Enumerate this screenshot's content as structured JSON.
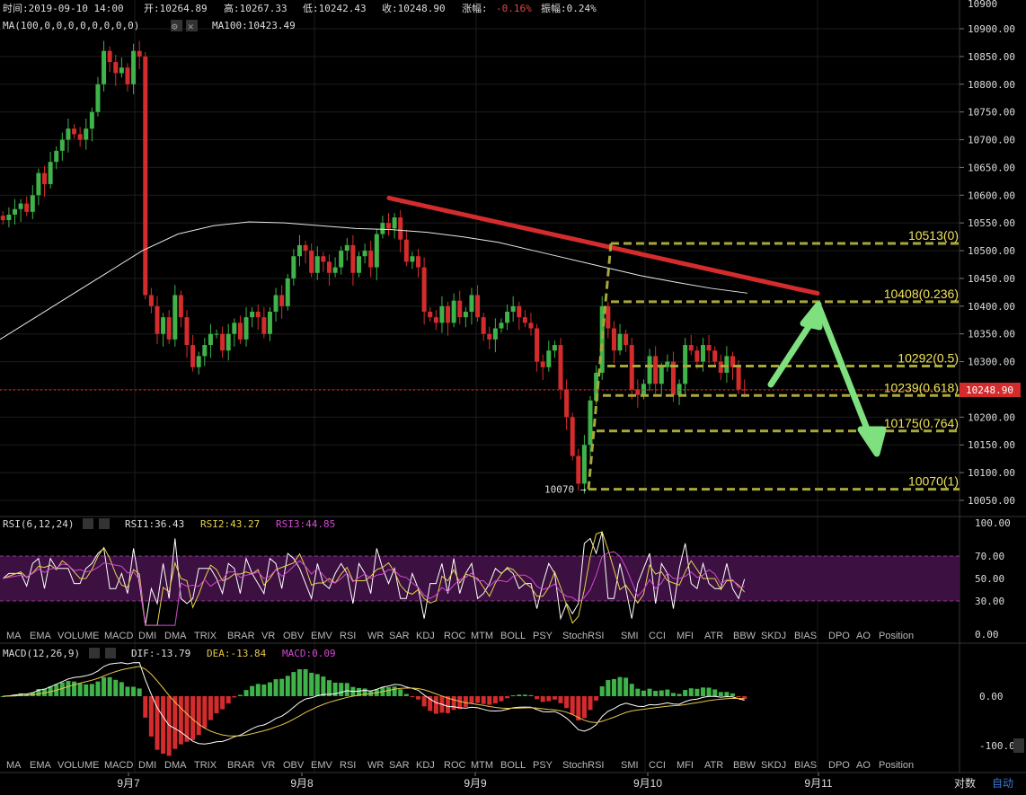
{
  "header": {
    "time": "时间:2019-09-10 14:00",
    "open": "开:10264.89",
    "high": "高:10267.33",
    "low": "低:10242.43",
    "close": "收:10248.90",
    "change_label": "涨幅:",
    "change_value": "-0.16%",
    "amplitude": "振幅:0.24%",
    "ma_params": "MA(100,0,0,0,0,0,0,0,0)",
    "ma_value": "MA100:10423.49"
  },
  "price_axis": {
    "ticks": [
      "10900.00",
      "10850.00",
      "10800.00",
      "10750.00",
      "10700.00",
      "10650.00",
      "10600.00",
      "10550.00",
      "10500.00",
      "10450.00",
      "10400.00",
      "10350.00",
      "10300.00",
      "10250.00",
      "10200.00",
      "10150.00",
      "10100.00",
      "10050.00"
    ],
    "top_tick": "10900",
    "current_price": "10248.90"
  },
  "fib": {
    "levels": [
      {
        "label": "10513(0)",
        "value": 10513
      },
      {
        "label": "10408(0.236)",
        "value": 10408
      },
      {
        "label": "10292(0.5)",
        "value": 10292
      },
      {
        "label": "10239(0.618)",
        "value": 10239
      },
      {
        "label": "10175(0.764)",
        "value": 10175
      },
      {
        "label": "10070(1)",
        "value": 10070
      }
    ],
    "low_marker": "10070 →"
  },
  "rsi": {
    "params": "RSI(6,12,24)",
    "rsi1": "RSI1:36.43",
    "rsi2": "RSI2:43.27",
    "rsi3": "RSI3:44.85",
    "ticks": [
      "100.00",
      "70.00",
      "50.00",
      "30.00",
      "0.00"
    ]
  },
  "macd": {
    "params": "MACD(12,26,9)",
    "dif": "DIF:-13.79",
    "dea": "DEA:-13.84",
    "macd": "MACD:0.09",
    "ticks": [
      "0.00",
      "-100.00"
    ]
  },
  "indicator_tabs": [
    "MA",
    "EMA",
    "VOLUME",
    "MACD",
    "DMI",
    "DMA",
    "TRIX",
    "BRAR",
    "VR",
    "OBV",
    "EMV",
    "RSI",
    "WR",
    "SAR",
    "KDJ",
    "ROC",
    "MTM",
    "BOLL",
    "PSY",
    "StochRSI",
    "SMI",
    "CCI",
    "MFI",
    "ATR",
    "BBW",
    "SKDJ",
    "BIAS",
    "DPO",
    "AO",
    "Position"
  ],
  "date_labels": [
    "9月7",
    "9月8",
    "9月9",
    "9月10",
    "9月11"
  ],
  "bottom_buttons": {
    "log": "对数",
    "auto": "自动"
  },
  "colors": {
    "up": "#3fb24a",
    "down": "#d42c2c",
    "ma100": "#e8e8e8",
    "trend": "#d42c2c",
    "fib": "#a8a83a",
    "arrow": "#7ee07e",
    "rsi1": "#ffffff",
    "rsi2": "#e6d24a",
    "rsi3": "#d24ad2",
    "dif": "#ffffff",
    "dea": "#e6c84a"
  },
  "chart_data": {
    "type": "candlestick",
    "interval": "1h",
    "x_dates": [
      "9月7",
      "9月8",
      "9月9",
      "9月10",
      "9月11"
    ],
    "ylim": [
      10040,
      10920
    ],
    "last_close": 10248.9,
    "ma100_last": 10423.49,
    "closes": [
      10555,
      10565,
      10575,
      10585,
      10570,
      10600,
      10640,
      10620,
      10660,
      10680,
      10700,
      10720,
      10710,
      10700,
      10720,
      10750,
      10800,
      10860,
      10840,
      10820,
      10830,
      10800,
      10860,
      10850,
      10420,
      10400,
      10350,
      10380,
      10340,
      10420,
      10380,
      10330,
      10290,
      10310,
      10330,
      10350,
      10350,
      10320,
      10350,
      10370,
      10340,
      10380,
      10390,
      10380,
      10350,
      10390,
      10420,
      10400,
      10450,
      10490,
      10510,
      10500,
      10460,
      10490,
      10480,
      10460,
      10470,
      10500,
      10510,
      10460,
      10490,
      10500,
      10470,
      10530,
      10550,
      10540,
      10560,
      10520,
      10480,
      10490,
      10470,
      10390,
      10380,
      10370,
      10400,
      10370,
      10410,
      10380,
      10390,
      10420,
      10380,
      10350,
      10340,
      10360,
      10370,
      10390,
      10400,
      10380,
      10370,
      10360,
      10300,
      10290,
      10320,
      10330,
      10250,
      10200,
      10130,
      10080,
      10150,
      10230,
      10280,
      10400,
      10360,
      10320,
      10350,
      10330,
      10250,
      10240,
      10260,
      10310,
      10260,
      10290,
      10300,
      10240,
      10260,
      10330,
      10320,
      10300,
      10330,
      10320,
      10300,
      10280,
      10310,
      10290,
      10250,
      10248.9
    ],
    "ma100": [
      10340,
      10380,
      10420,
      10460,
      10500,
      10530,
      10545,
      10552,
      10550,
      10545,
      10540,
      10538,
      10533,
      10525,
      10515,
      10500,
      10485,
      10470,
      10455,
      10443,
      10432,
      10423.49
    ],
    "fib_levels": [
      10513,
      10408,
      10292,
      10239,
      10175,
      10070
    ],
    "rsi": {
      "ylim": [
        0,
        100
      ],
      "last": {
        "RSI1": 36.43,
        "RSI2": 43.27,
        "RSI3": 44.85
      }
    },
    "macd": {
      "last": {
        "DIF": -13.79,
        "DEA": -13.84,
        "MACD": 0.09
      }
    }
  }
}
